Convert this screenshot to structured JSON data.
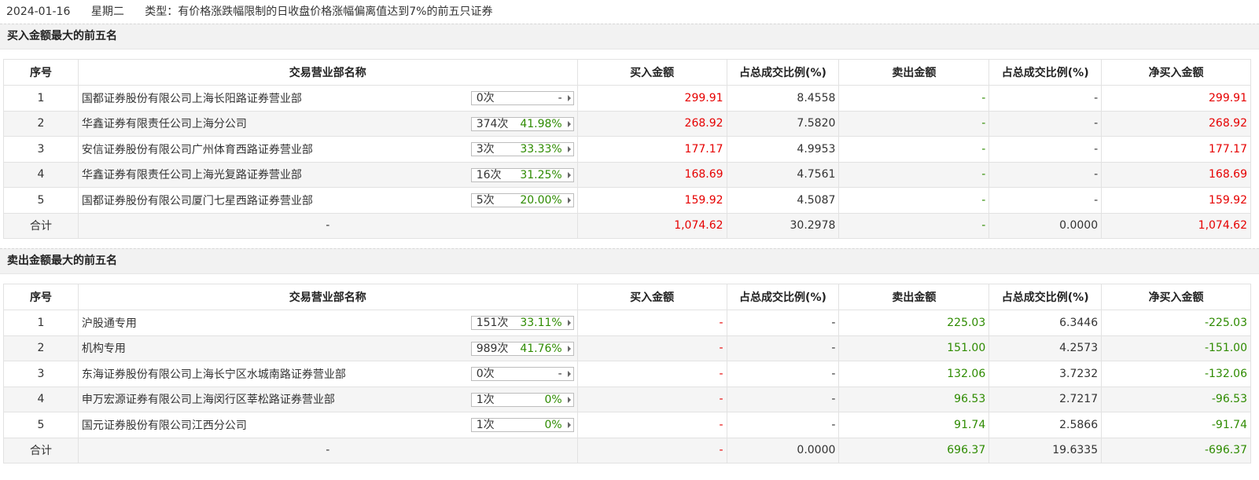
{
  "header": {
    "date": "2024-01-16",
    "weekday": "星期二",
    "type_label": "类型：有价格涨跌幅限制的日收盘价格涨幅偏离值达到7%的前五只证券"
  },
  "columns": [
    "序号",
    "交易营业部名称",
    "买入金额",
    "占总成交比例(%)",
    "卖出金额",
    "占总成交比例(%)",
    "净买入金额"
  ],
  "colors": {
    "up": "#e60000",
    "down": "#2e8b00",
    "text": "#333333"
  },
  "buy_section": {
    "title": "买入金额最大的前五名",
    "rows": [
      {
        "rank": "1",
        "name": "国都证券股份有限公司上海长阳路证券营业部",
        "times": "0次",
        "ratio": "-",
        "buy": "299.91",
        "buy_pct": "8.4558",
        "sell": "-",
        "sell_pct": "-",
        "net": "299.91"
      },
      {
        "rank": "2",
        "name": "华鑫证券有限责任公司上海分公司",
        "times": "374次",
        "ratio": "41.98%",
        "buy": "268.92",
        "buy_pct": "7.5820",
        "sell": "-",
        "sell_pct": "-",
        "net": "268.92"
      },
      {
        "rank": "3",
        "name": "安信证券股份有限公司广州体育西路证券营业部",
        "times": "3次",
        "ratio": "33.33%",
        "buy": "177.17",
        "buy_pct": "4.9953",
        "sell": "-",
        "sell_pct": "-",
        "net": "177.17"
      },
      {
        "rank": "4",
        "name": "华鑫证券有限责任公司上海光复路证券营业部",
        "times": "16次",
        "ratio": "31.25%",
        "buy": "168.69",
        "buy_pct": "4.7561",
        "sell": "-",
        "sell_pct": "-",
        "net": "168.69"
      },
      {
        "rank": "5",
        "name": "国都证券股份有限公司厦门七星西路证券营业部",
        "times": "5次",
        "ratio": "20.00%",
        "buy": "159.92",
        "buy_pct": "4.5087",
        "sell": "-",
        "sell_pct": "-",
        "net": "159.92"
      }
    ],
    "total": {
      "label": "合计",
      "name": "-",
      "buy": "1,074.62",
      "buy_pct": "30.2978",
      "sell": "-",
      "sell_pct": "0.0000",
      "net": "1,074.62"
    }
  },
  "sell_section": {
    "title": "卖出金额最大的前五名",
    "rows": [
      {
        "rank": "1",
        "name": "沪股通专用",
        "times": "151次",
        "ratio": "33.11%",
        "buy": "-",
        "buy_pct": "-",
        "sell": "225.03",
        "sell_pct": "6.3446",
        "net": "-225.03"
      },
      {
        "rank": "2",
        "name": "机构专用",
        "times": "989次",
        "ratio": "41.76%",
        "buy": "-",
        "buy_pct": "-",
        "sell": "151.00",
        "sell_pct": "4.2573",
        "net": "-151.00"
      },
      {
        "rank": "3",
        "name": "东海证券股份有限公司上海长宁区水城南路证券营业部",
        "times": "0次",
        "ratio": "-",
        "buy": "-",
        "buy_pct": "-",
        "sell": "132.06",
        "sell_pct": "3.7232",
        "net": "-132.06"
      },
      {
        "rank": "4",
        "name": "申万宏源证券有限公司上海闵行区莘松路证券营业部",
        "times": "1次",
        "ratio": "0%",
        "buy": "-",
        "buy_pct": "-",
        "sell": "96.53",
        "sell_pct": "2.7217",
        "net": "-96.53"
      },
      {
        "rank": "5",
        "name": "国元证券股份有限公司江西分公司",
        "times": "1次",
        "ratio": "0%",
        "buy": "-",
        "buy_pct": "-",
        "sell": "91.74",
        "sell_pct": "2.5866",
        "net": "-91.74"
      }
    ],
    "total": {
      "label": "合计",
      "name": "-",
      "buy": "-",
      "buy_pct": "0.0000",
      "sell": "696.37",
      "sell_pct": "19.6335",
      "net": "-696.37"
    }
  }
}
